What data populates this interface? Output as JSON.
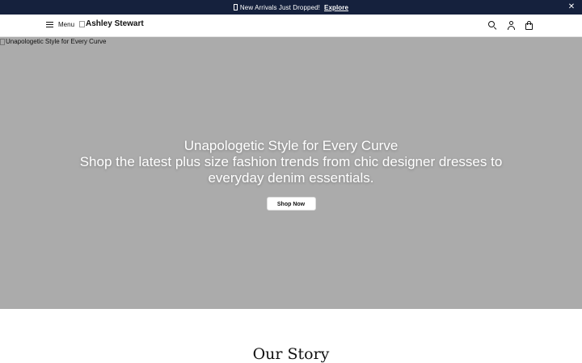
{
  "announcement": {
    "message": "New Arrivals Just Dropped!",
    "cta": "Explore",
    "close_glyph": "✕",
    "bg_color": "#15213d"
  },
  "header": {
    "menu_label": "Menu",
    "brand": "Ashley Stewart",
    "icons": [
      "search-icon",
      "account-icon",
      "bag-icon"
    ]
  },
  "hero": {
    "image_alt": "Unapologetic Style for Every Curve",
    "title": "Unapologetic Style for Every Curve",
    "subtitle": "Shop the latest plus size fashion trends from chic designer dresses to everyday denim essentials.",
    "button_label": "Shop Now",
    "bg_color": "#ababab"
  },
  "story": {
    "title": "Our Story"
  }
}
